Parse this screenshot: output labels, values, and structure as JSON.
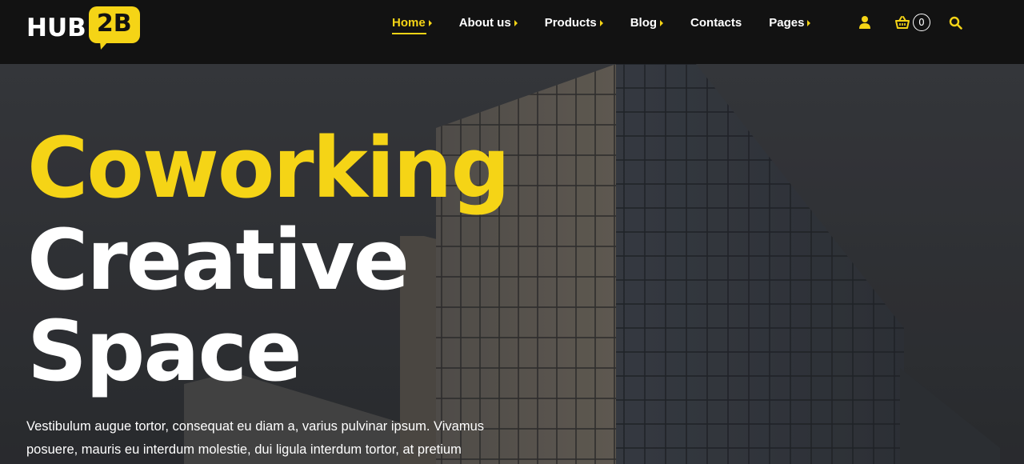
{
  "brand": {
    "logo_main": "HUB",
    "logo_badge": "2B"
  },
  "colors": {
    "accent": "#f5d416",
    "header_bg": "#121212",
    "text": "#ffffff"
  },
  "nav": {
    "items": [
      {
        "label": "Home",
        "has_submenu": true,
        "active": true
      },
      {
        "label": "About us",
        "has_submenu": true
      },
      {
        "label": "Products",
        "has_submenu": true
      },
      {
        "label": "Blog",
        "has_submenu": true
      },
      {
        "label": "Contacts",
        "has_submenu": false
      },
      {
        "label": "Pages",
        "has_submenu": true
      }
    ]
  },
  "tools": {
    "user_icon": "user-icon",
    "cart_icon": "basket-icon",
    "cart_count": "0",
    "search_icon": "search-icon"
  },
  "hero": {
    "line1": "Coworking",
    "line2": "Creative",
    "line3": "Space",
    "text": "Vestibulum augue tortor, consequat eu diam a, varius pulvinar ipsum. Vivamus posuere, mauris eu interdum molestie, dui ligula interdum tortor, at pretium"
  }
}
